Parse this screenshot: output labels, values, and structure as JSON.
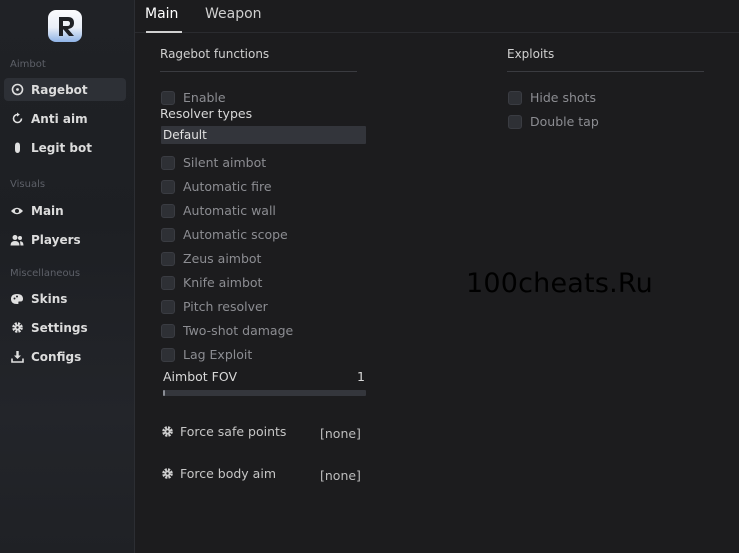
{
  "sidebar": {
    "sections": [
      {
        "title": "Aimbot",
        "items": [
          {
            "label": "Ragebot",
            "icon": "crosshair-icon",
            "active": true
          },
          {
            "label": "Anti aim",
            "icon": "rotate-icon",
            "active": false
          },
          {
            "label": "Legit bot",
            "icon": "mouse-icon",
            "active": false
          }
        ]
      },
      {
        "title": "Visuals",
        "items": [
          {
            "label": "Main",
            "icon": "eye-icon",
            "active": false
          },
          {
            "label": "Players",
            "icon": "users-icon",
            "active": false
          }
        ]
      },
      {
        "title": "Miscellaneous",
        "items": [
          {
            "label": "Skins",
            "icon": "palette-icon",
            "active": false
          },
          {
            "label": "Settings",
            "icon": "gear-icon",
            "active": false
          },
          {
            "label": "Configs",
            "icon": "download-icon",
            "active": false
          }
        ]
      }
    ]
  },
  "tabs": [
    {
      "label": "Main",
      "active": true
    },
    {
      "label": "Weapon",
      "active": false
    }
  ],
  "ragebot": {
    "title": "Ragebot functions",
    "enable_label": "Enable",
    "resolver_label": "Resolver types",
    "resolver_value": "Default",
    "checkboxes": [
      "Silent aimbot",
      "Automatic fire",
      "Automatic wall",
      "Automatic scope",
      "Zeus aimbot",
      "Knife aimbot",
      "Pitch resolver",
      "Two-shot damage",
      "Lag Exploit"
    ],
    "fov_label": "Aimbot FOV",
    "fov_value": "1",
    "fov_fraction": 0.01,
    "binds": [
      {
        "label": "Force safe points",
        "value": "[none]"
      },
      {
        "label": "Force body aim",
        "value": "[none]"
      }
    ]
  },
  "exploits": {
    "title": "Exploits",
    "checkboxes": [
      "Hide shots",
      "Double tap"
    ]
  },
  "watermark": "100cheats.Ru"
}
